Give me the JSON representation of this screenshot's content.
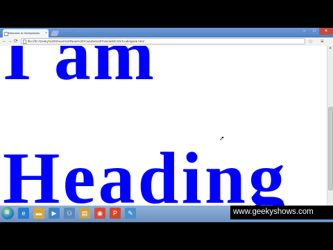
{
  "browser": {
    "tab_title": "Welcome to Geekyshows",
    "tab_close": "×",
    "blurred_tabs": "· · · · · · ·",
    "window_buttons": {
      "minimize": "–",
      "maximize": "□",
      "close": "✕"
    },
    "nav": {
      "back": "←",
      "forward": "→",
      "reload": "⟳"
    },
    "url": "file:///E:/Geeky%20Shows%20New%20Youtube%20Tutorials/CSS/Code/geek.html"
  },
  "page": {
    "heading_line1": "I am",
    "heading_line2": "Heading",
    "heading_color": "#0000ff"
  },
  "taskbar": {
    "icons": [
      {
        "name": "ie-icon",
        "glyph": "e",
        "color": "#2a7bd0"
      },
      {
        "name": "folder-icon",
        "glyph": "▬",
        "color": "#d8a637"
      },
      {
        "name": "media-player-icon",
        "glyph": "▶",
        "color": "#3f82c9"
      },
      {
        "name": "network-icon",
        "glyph": "⚇",
        "color": "#5a88b8"
      },
      {
        "name": "file-explorer-icon",
        "glyph": "▤",
        "color": "#c9a04a"
      },
      {
        "name": "chrome-icon",
        "glyph": "◉",
        "color": "#d84a3a"
      },
      {
        "name": "powerpoint-icon",
        "glyph": "P",
        "color": "#d2472b"
      },
      {
        "name": "paint-icon",
        "glyph": "✎",
        "color": "#4a8fd0"
      }
    ]
  },
  "watermark": "www.geekyshows.com"
}
